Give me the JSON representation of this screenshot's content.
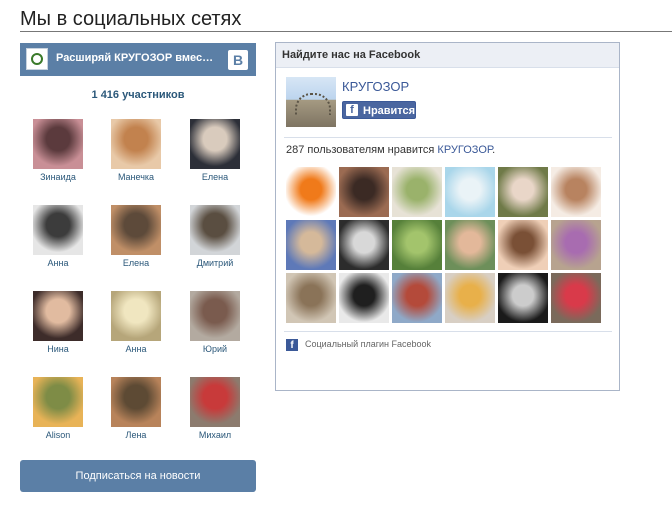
{
  "page": {
    "title": "Мы в социальных сетях"
  },
  "vk": {
    "group_title": "Расширяй КРУГОЗОР вмес…",
    "logo": "В",
    "avatar_icon": "group-avatar-icon",
    "members_count": "1 416 участников",
    "members": [
      {
        "name": "Зинаида",
        "c1": "#c98f96",
        "c2": "#5b3a3d"
      },
      {
        "name": "Манечка",
        "c1": "#e8c9a8",
        "c2": "#c2824e"
      },
      {
        "name": "Елена",
        "c1": "#2c2f38",
        "c2": "#d9cbbd"
      },
      {
        "name": "Анна",
        "c1": "#e6e6e6",
        "c2": "#3c3c3c"
      },
      {
        "name": "Елена",
        "c1": "#c08f67",
        "c2": "#5d4a3a"
      },
      {
        "name": "Дмитрий",
        "c1": "#d2d5d8",
        "c2": "#5a4e41"
      },
      {
        "name": "Нина",
        "c1": "#3d2c2a",
        "c2": "#e1bba0"
      },
      {
        "name": "Анна",
        "c1": "#b6a67a",
        "c2": "#f0e6c0"
      },
      {
        "name": "Юрий",
        "c1": "#b3aaa0",
        "c2": "#7a5b4e"
      },
      {
        "name": "Alison",
        "c1": "#e8b357",
        "c2": "#7e8c46"
      },
      {
        "name": "Лена",
        "c1": "#b8835a",
        "c2": "#5d4a34"
      },
      {
        "name": "Михаил",
        "c1": "#8c7b6e",
        "c2": "#c83a3a"
      }
    ],
    "subscribe_label": "Подписаться на новости"
  },
  "facebook": {
    "header": "Найдите нас на Facebook",
    "page_name": "КРУГОЗОР",
    "like_label": "Нравится",
    "like_icon": "f",
    "likes_text": "287 пользователям нравится ",
    "likes_link": "КРУГОЗОР",
    "likes_suffix": ".",
    "faces": [
      {
        "c1": "#ffffff",
        "c2": "#f07a1a"
      },
      {
        "c1": "#9b6b52",
        "c2": "#3b2a24"
      },
      {
        "c1": "#e7e2d6",
        "c2": "#9ab26b"
      },
      {
        "c1": "#a9d6ea",
        "c2": "#eaf3f7"
      },
      {
        "c1": "#6f7a48",
        "c2": "#e9d6c8"
      },
      {
        "c1": "#f5ece4",
        "c2": "#b88360"
      },
      {
        "c1": "#5e79b8",
        "c2": "#d5b99a"
      },
      {
        "c1": "#2c2c2c",
        "c2": "#d8d8d8"
      },
      {
        "c1": "#56803a",
        "c2": "#a3c46c"
      },
      {
        "c1": "#6d8f5a",
        "c2": "#e3b89a"
      },
      {
        "c1": "#efcfb7",
        "c2": "#7a5036"
      },
      {
        "c1": "#b7a38f",
        "c2": "#a86cb0"
      },
      {
        "c1": "#d1c6b5",
        "c2": "#8a7358"
      },
      {
        "c1": "#e9e9e9",
        "c2": "#1f1f1f"
      },
      {
        "c1": "#8fa9c8",
        "c2": "#b44a3a"
      },
      {
        "c1": "#d8cfc4",
        "c2": "#e8b04a"
      },
      {
        "c1": "#1a1a1a",
        "c2": "#cccccc"
      },
      {
        "c1": "#7a6a5b",
        "c2": "#d93a4a"
      }
    ],
    "footer_icon": "f",
    "footer_label": "Социальный плагин Facebook"
  }
}
